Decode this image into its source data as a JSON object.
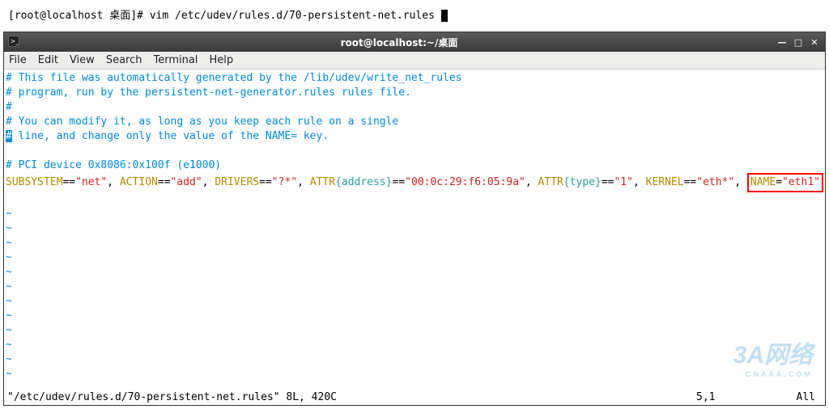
{
  "top_prompt": {
    "text": "[root@localhost 桌面]# vim /etc/udev/rules.d/70-persistent-net.rules "
  },
  "window": {
    "title": "root@localhost:~/桌面",
    "min_icon": "—",
    "max_icon": "□",
    "close_icon": "✕"
  },
  "menubar": {
    "file": "File",
    "edit": "Edit",
    "view": "View",
    "search": "Search",
    "terminal": "Terminal",
    "help": "Help"
  },
  "editor": {
    "comment1": "# This file was automatically generated by the /lib/udev/write_net_rules",
    "comment2": "# program, run by the persistent-net-generator.rules rules file.",
    "comment3": "#",
    "comment4": "# You can modify it, as long as you keep each rule on a single",
    "comment5_hash": "#",
    "comment5_rest": " line, and change only the value of the NAME= key.",
    "comment6": "# PCI device 0x8086:0x100f (e1000)",
    "rule": {
      "k_subsystem": "SUBSYSTEM",
      "v_subsystem": "\"net\"",
      "k_action": "ACTION",
      "v_action": "\"add\"",
      "k_drivers": "DRIVERS",
      "v_drivers": "\"?*\"",
      "k_attr_addr": "ATTR",
      "a_attr_addr": "{address}",
      "v_attr_addr": "\"00:0c:29:f6:05:9a\"",
      "k_attr_type": "ATTR",
      "a_attr_type": "{type}",
      "v_attr_type": "\"1\"",
      "k_kernel": "KERNEL",
      "v_kernel": "\"eth*\"",
      "k_name": "NAME",
      "v_name": "\"eth1\""
    },
    "tilde": "~"
  },
  "statusline": {
    "left": "\"/etc/udev/rules.d/70-persistent-net.rules\" 8L, 420C",
    "mid": "5,1",
    "right": "All"
  },
  "watermark": {
    "main": "3A网络",
    "sub": "CNAAA.COM"
  }
}
